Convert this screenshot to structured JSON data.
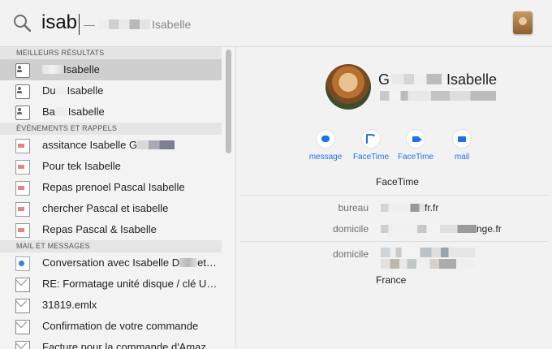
{
  "search": {
    "query": "isab",
    "completion": "— Isabelle"
  },
  "sections": [
    {
      "title": "MEILLEURS RÉSULTATS",
      "items": [
        {
          "label": "G Isabelle",
          "icon": "contact-card-icon",
          "selected": true
        },
        {
          "label": "Du Isabelle",
          "icon": "contact-card-icon"
        },
        {
          "label": "Ba Isabelle",
          "icon": "contact-card-icon"
        }
      ]
    },
    {
      "title": "ÉVÉNEMENTS ET RAPPELS",
      "items": [
        {
          "label": "assitance Isabelle G",
          "icon": "calendar-doc-icon"
        },
        {
          "label": "Pour tek Isabelle",
          "icon": "calendar-doc-icon"
        },
        {
          "label": "Repas prenoel Pascal Isabelle",
          "icon": "calendar-doc-icon"
        },
        {
          "label": "chercher Pascal et isabelle",
          "icon": "calendar-doc-icon"
        },
        {
          "label": "Repas Pascal & Isabelle",
          "icon": "calendar-doc-icon"
        }
      ]
    },
    {
      "title": "MAIL ET MESSAGES",
      "items": [
        {
          "label": "Conversation avec Isabelle D et…",
          "icon": "conversation-icon"
        },
        {
          "label": "RE: Formatage unité disque / clé U…",
          "icon": "mail-envelope-icon"
        },
        {
          "label": "31819.emlx",
          "icon": "mail-envelope-icon"
        },
        {
          "label": "Confirmation de votre commande",
          "icon": "mail-envelope-icon"
        },
        {
          "label": "Facture pour la commande d'Amaz…",
          "icon": "mail-envelope-icon"
        }
      ]
    }
  ],
  "contact": {
    "name_first": "G",
    "name_last": "Isabelle",
    "actions": [
      {
        "label": "message",
        "icon": "message-bubble-icon"
      },
      {
        "label": "FaceTime",
        "icon": "phone-icon"
      },
      {
        "label": "FaceTime",
        "icon": "video-camera-icon"
      },
      {
        "label": "mail",
        "icon": "mail-icon"
      }
    ],
    "facetime_label": "FaceTime",
    "fields": [
      {
        "label": "bureau",
        "value": "fr.fr"
      },
      {
        "label": "domicile",
        "value": "nge.fr"
      },
      {
        "label": "domicile",
        "value": ""
      }
    ],
    "country": "France"
  },
  "colors": {
    "accent": "#1a73e8",
    "selection": "#cfcfcf"
  }
}
